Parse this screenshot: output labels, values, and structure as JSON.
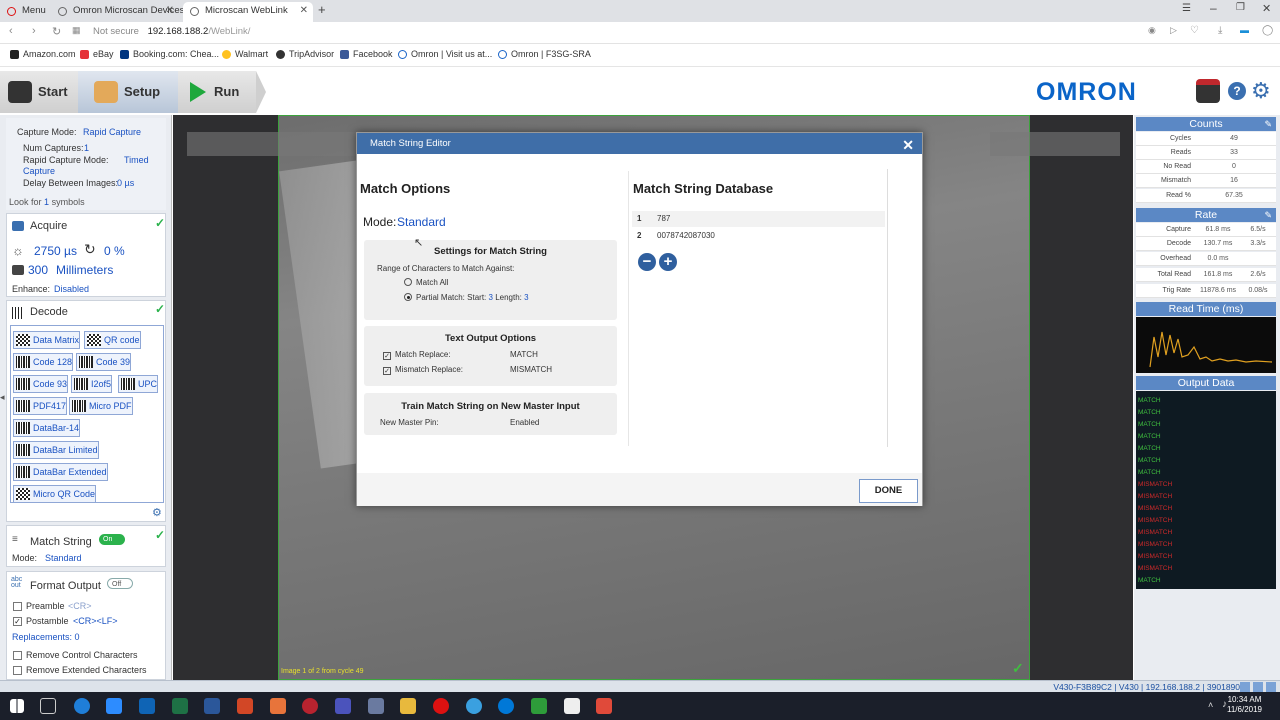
{
  "browser": {
    "tabs": [
      {
        "label": "Menu"
      },
      {
        "label": "Omron Microscan Devices"
      },
      {
        "label": "Microscan WebLink"
      }
    ],
    "security": "Not secure",
    "url_host": "192.168.188.2",
    "url_path": "/WebLink/",
    "bookmarks": [
      "Amazon.com",
      "eBay",
      "Booking.com: Chea...",
      "Walmart",
      "TripAdvisor",
      "Facebook",
      "Omron | Visit us at...",
      "Omron | F3SG-SRA"
    ]
  },
  "toolbar": {
    "start": "Start",
    "setup": "Setup",
    "run": "Run",
    "logo": "OMRON"
  },
  "left": {
    "capture_mode_label": "Capture Mode:",
    "capture_mode_value": "Rapid Capture",
    "num_captures_label": "Num Captures:",
    "num_captures_value": "1",
    "rapid_mode_label": "Rapid Capture Mode:",
    "rapid_mode_value": "Timed",
    "rapid_mode_value2": "Capture",
    "delay_label": "Delay Between Images:",
    "delay_value": "0 µs",
    "look_for": "Look for",
    "look_for_n": "1",
    "look_for_unit": "symbols",
    "acquire": "Acquire",
    "exposure": "2750 µs",
    "gain": "0 %",
    "distance": "300",
    "distance_unit": "Millimeters",
    "enhance_label": "Enhance:",
    "enhance_value": "Disabled",
    "decode": "Decode",
    "symbologies": [
      "Data Matrix",
      "QR code",
      "Code 128",
      "Code 39",
      "Code 93",
      "I2of5",
      "UPC",
      "PDF417",
      "Micro PDF",
      "DataBar-14",
      "DataBar Limited",
      "DataBar Extended",
      "Micro QR Code"
    ],
    "match_string": "Match String",
    "match_toggle": "On",
    "mode_label": "Mode:",
    "mode_value": "Standard",
    "format_output": "Format Output",
    "format_toggle": "Off",
    "preamble": "Preamble",
    "preamble_val": "<CR>",
    "postamble": "Postamble",
    "postamble_val": "<CR><LF>",
    "replacements": "Replacements: 0",
    "remove_control": "Remove Control Characters",
    "remove_extended": "Remove Extended Characters"
  },
  "viewer": {
    "caption": "Image 1 of 2 from cycle 49"
  },
  "dialog": {
    "title": "Match String Editor",
    "match_options": "Match Options",
    "mode_label": "Mode:",
    "mode_value": "Standard",
    "settings_title": "Settings for Match String",
    "range_label": "Range of Characters to Match Against:",
    "match_all": "Match All",
    "partial_match": "Partial Match:",
    "start_label": "Start:",
    "start_val": "3",
    "length_label": "Length:",
    "length_val": "3",
    "text_output_title": "Text Output Options",
    "match_replace_label": "Match Replace:",
    "match_replace_val": "MATCH",
    "mismatch_replace_label": "Mismatch Replace:",
    "mismatch_replace_val": "MISMATCH",
    "train_title": "Train Match String on New Master Input",
    "master_pin_label": "New Master Pin:",
    "master_pin_val": "Enabled",
    "db_title": "Match String Database",
    "db_rows": [
      {
        "idx": "1",
        "value": "787"
      },
      {
        "idx": "2",
        "value": "0078742087030"
      }
    ],
    "done": "DONE"
  },
  "right": {
    "counts_title": "Counts",
    "counts": [
      {
        "k": "Cycles",
        "v": "49"
      },
      {
        "k": "Reads",
        "v": "33"
      },
      {
        "k": "No Read",
        "v": "0"
      },
      {
        "k": "Mismatch",
        "v": "16"
      },
      {
        "k": "Read %",
        "v": "67.35"
      }
    ],
    "rate_title": "Rate",
    "rates": [
      {
        "k": "Capture",
        "v": "61.8 ms",
        "v2": "6.5/s"
      },
      {
        "k": "Decode",
        "v": "130.7 ms",
        "v2": "3.3/s"
      },
      {
        "k": "Overhead",
        "v": "0.0 ms",
        "v2": ""
      },
      {
        "k": "Total Read",
        "v": "161.8 ms",
        "v2": "2.6/s"
      },
      {
        "k": "Trig Rate",
        "v": "11878.6 ms",
        "v2": "0.08/s"
      }
    ],
    "readtime_title": "Read Time (ms)",
    "output_title": "Output Data",
    "output_lines": [
      "MATCH",
      "MATCH",
      "MATCH",
      "MATCH",
      "MATCH",
      "MATCH",
      "MATCH",
      "MISMATCH",
      "MISMATCH",
      "MISMATCH",
      "MISMATCH",
      "MISMATCH",
      "MISMATCH",
      "MISMATCH",
      "MISMATCH",
      "MATCH"
    ]
  },
  "status": {
    "text": "V430-F3B89C2 | V430 | 192.168.188.2 | 3901890"
  },
  "clock": {
    "time": "10:34 AM",
    "date": "11/6/2019"
  },
  "colors": {
    "accent": "#3f6ea8",
    "link": "#1a52c2",
    "match": "#3fbf3f",
    "mismatch": "#d02a2a"
  }
}
